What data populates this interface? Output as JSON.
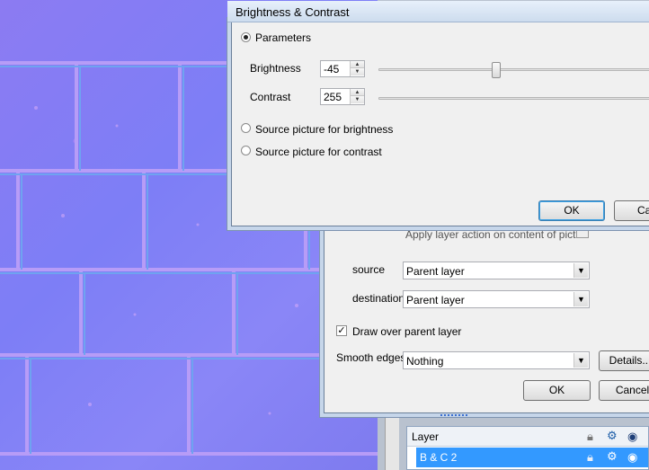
{
  "dialog_bc": {
    "title": "Brightness & Contrast",
    "parameters_label": "Parameters",
    "brightness_label": "Brightness",
    "brightness_value": "-45",
    "contrast_label": "Contrast",
    "contrast_value": "255",
    "source_brightness_label": "Source picture for brightness",
    "source_contrast_label": "Source picture for contrast",
    "ok_label": "OK",
    "cancel_label": "Can"
  },
  "dialog_layer": {
    "hidden_text": "Apply layer action on content of pictu",
    "source_label": "source",
    "source_value": "Parent layer",
    "destination_label": "destination",
    "destination_value": "Parent layer",
    "draw_over_label": "Draw over parent layer",
    "smooth_edges_label": "Smooth edges",
    "smooth_edges_value": "Nothing",
    "details_label": "Details...",
    "ok_label": "OK",
    "cancel_label": "Cancel"
  },
  "layers_panel": {
    "header_label": "Layer",
    "row_label": "B & C 2"
  },
  "colors": {
    "selection": "#3399ff",
    "canvas_purple": "#8080f0"
  }
}
